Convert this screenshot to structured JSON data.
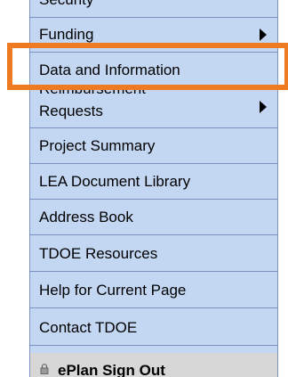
{
  "menu": {
    "clipped_item_label": "Security",
    "items": [
      {
        "label": "Funding",
        "has_submenu": true
      },
      {
        "label": "Data and Information",
        "has_submenu": false
      },
      {
        "label_top": "Reimbursement",
        "label_bottom": "Requests",
        "has_submenu": true
      },
      {
        "label": "Project Summary",
        "has_submenu": false
      },
      {
        "label": "LEA Document Library",
        "has_submenu": false
      },
      {
        "label": "Address Book",
        "has_submenu": false
      },
      {
        "label": "TDOE Resources",
        "has_submenu": false
      },
      {
        "label": "Help for Current Page",
        "has_submenu": false
      },
      {
        "label": "Contact TDOE",
        "has_submenu": false
      }
    ],
    "signout_label": "ePlan Sign Out",
    "signout_icon": "lock-icon"
  },
  "highlight": {
    "color": "#ee7a22",
    "target": "Data and Information"
  },
  "colors": {
    "menu_background": "#c3d6f2",
    "separator": "#7a93c2",
    "signout_background": "#d7d7d7"
  }
}
